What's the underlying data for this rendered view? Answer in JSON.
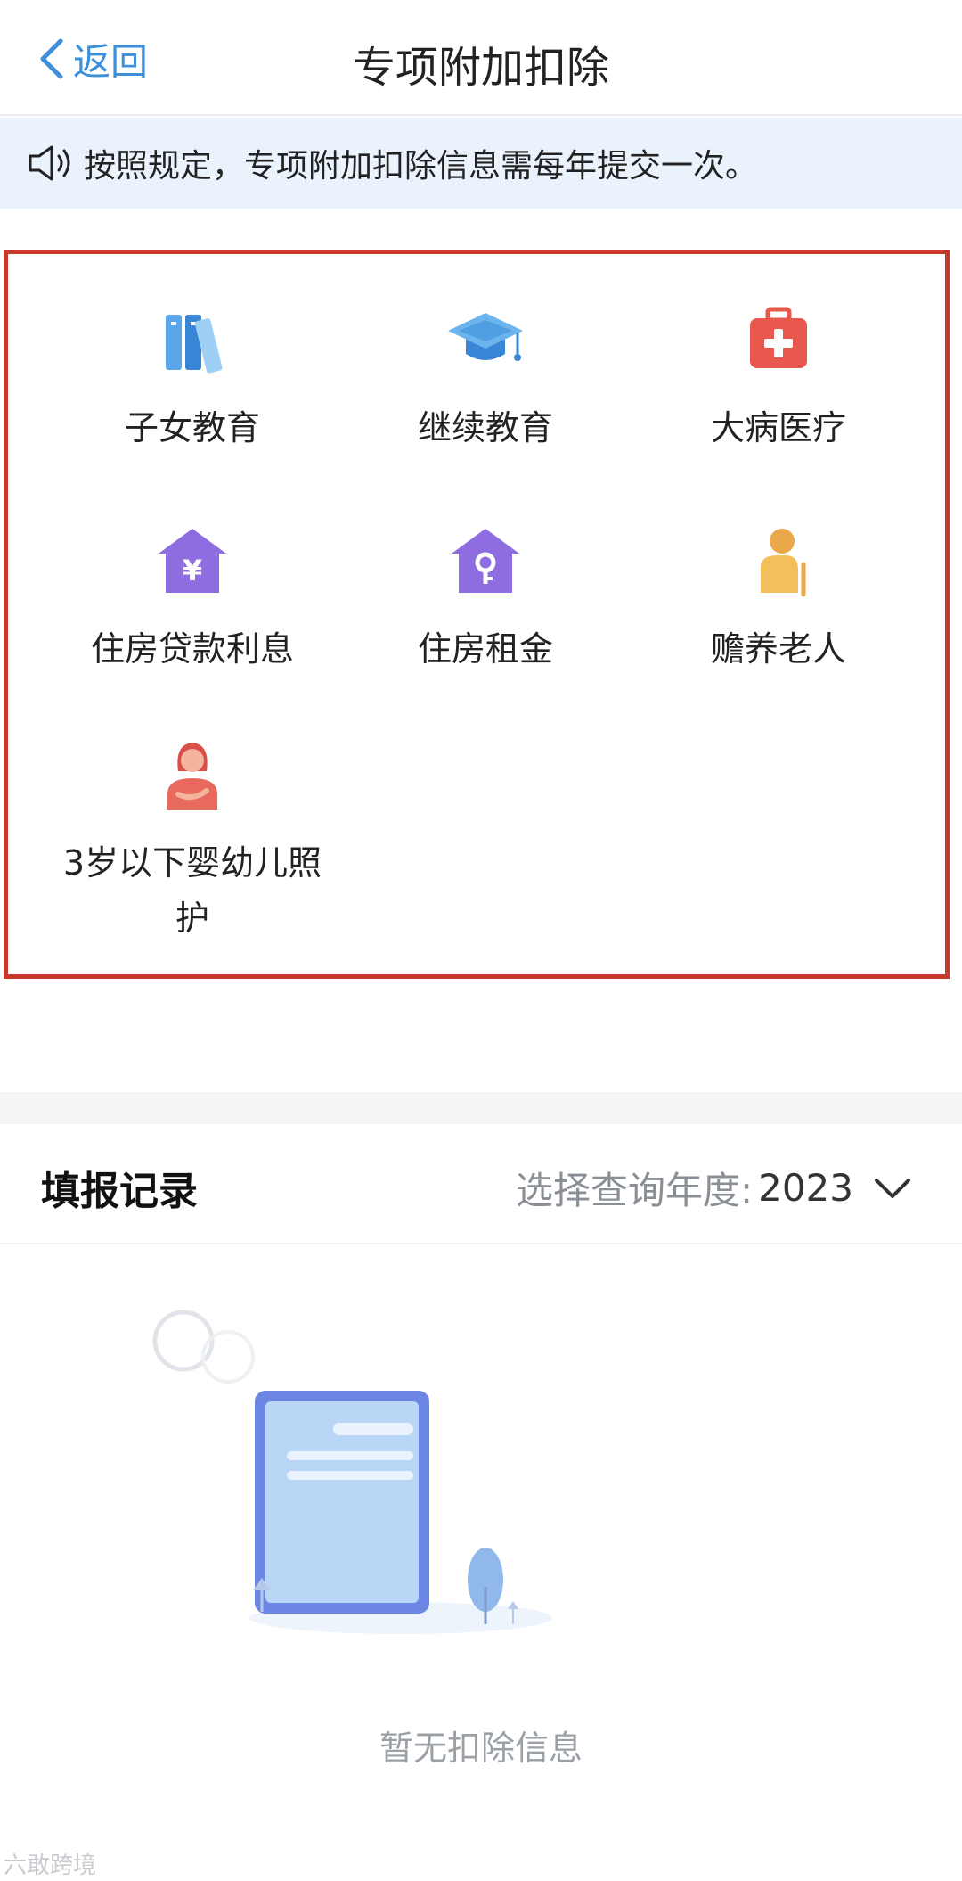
{
  "header": {
    "back_label": "返回",
    "title": "专项附加扣除"
  },
  "notice": {
    "text": "按照规定，专项附加扣除信息需每年提交一次。"
  },
  "options": [
    {
      "label": "子女教育",
      "icon": "books-icon"
    },
    {
      "label": "继续教育",
      "icon": "graduation-cap-icon"
    },
    {
      "label": "大病医疗",
      "icon": "medical-kit-icon"
    },
    {
      "label": "住房贷款利息",
      "icon": "house-yuan-icon"
    },
    {
      "label": "住房租金",
      "icon": "house-key-icon"
    },
    {
      "label": "赡养老人",
      "icon": "elderly-icon"
    },
    {
      "label": "3岁以下婴幼儿照护",
      "icon": "caregiver-icon"
    }
  ],
  "records": {
    "title": "填报记录",
    "year_label": "选择查询年度:",
    "year_value": "2023",
    "empty_text": "暂无扣除信息"
  },
  "watermark": "六敢跨境",
  "colors": {
    "accent": "#3c8fd8",
    "highlight_border": "#c63a2c",
    "notice_bg": "#eaf3fc"
  }
}
